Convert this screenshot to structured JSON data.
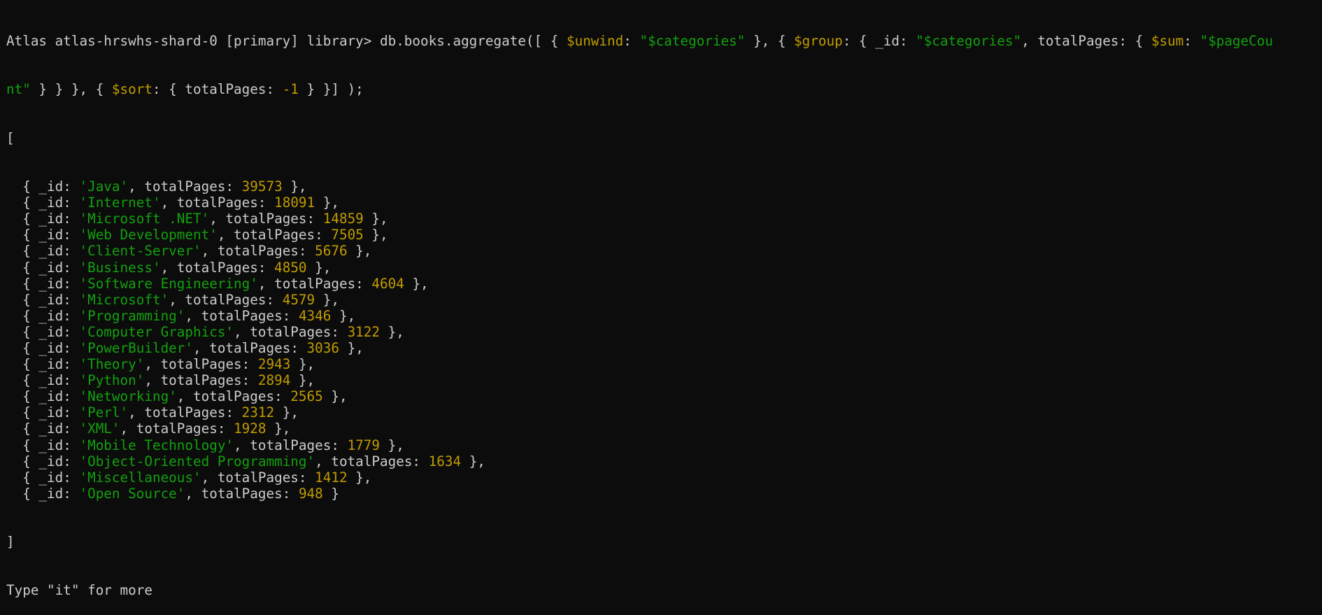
{
  "colors": {
    "background": "#0c0c0c",
    "text": "#cccccc",
    "operator": "#c19c00",
    "string": "#13a10e",
    "number": "#c19c00"
  },
  "prompt": {
    "line1": [
      {
        "t": "Atlas atlas-hrswhs-shard-0 [primary] library> db.books.aggregate([ { ",
        "c": "default"
      },
      {
        "t": "$unwind",
        "c": "op"
      },
      {
        "t": ": ",
        "c": "default"
      },
      {
        "t": "\"$categories\"",
        "c": "str"
      },
      {
        "t": " }, { ",
        "c": "default"
      },
      {
        "t": "$group",
        "c": "op"
      },
      {
        "t": ": { _id: ",
        "c": "default"
      },
      {
        "t": "\"$categories\"",
        "c": "str"
      },
      {
        "t": ", totalPages: { ",
        "c": "default"
      },
      {
        "t": "$sum",
        "c": "op"
      },
      {
        "t": ": ",
        "c": "default"
      },
      {
        "t": "\"$pageCou",
        "c": "str"
      }
    ],
    "line2": [
      {
        "t": "nt\"",
        "c": "str"
      },
      {
        "t": " } } }, { ",
        "c": "default"
      },
      {
        "t": "$sort",
        "c": "op"
      },
      {
        "t": ": { totalPages: ",
        "c": "default"
      },
      {
        "t": "-1",
        "c": "num"
      },
      {
        "t": " } }] );",
        "c": "default"
      }
    ]
  },
  "result": {
    "open_bracket": "[",
    "close_bracket": "]",
    "field_id": "_id",
    "field_total": "totalPages",
    "rows": [
      {
        "id": "'Java'",
        "total": "39573"
      },
      {
        "id": "'Internet'",
        "total": "18091"
      },
      {
        "id": "'Microsoft .NET'",
        "total": "14859"
      },
      {
        "id": "'Web Development'",
        "total": "7505"
      },
      {
        "id": "'Client-Server'",
        "total": "5676"
      },
      {
        "id": "'Business'",
        "total": "4850"
      },
      {
        "id": "'Software Engineering'",
        "total": "4604"
      },
      {
        "id": "'Microsoft'",
        "total": "4579"
      },
      {
        "id": "'Programming'",
        "total": "4346"
      },
      {
        "id": "'Computer Graphics'",
        "total": "3122"
      },
      {
        "id": "'PowerBuilder'",
        "total": "3036"
      },
      {
        "id": "'Theory'",
        "total": "2943"
      },
      {
        "id": "'Python'",
        "total": "2894"
      },
      {
        "id": "'Networking'",
        "total": "2565"
      },
      {
        "id": "'Perl'",
        "total": "2312"
      },
      {
        "id": "'XML'",
        "total": "1928"
      },
      {
        "id": "'Mobile Technology'",
        "total": "1779"
      },
      {
        "id": "'Object-Oriented Programming'",
        "total": "1634"
      },
      {
        "id": "'Miscellaneous'",
        "total": "1412"
      },
      {
        "id": "'Open Source'",
        "total": "948"
      }
    ]
  },
  "footer": "Type \"it\" for more"
}
